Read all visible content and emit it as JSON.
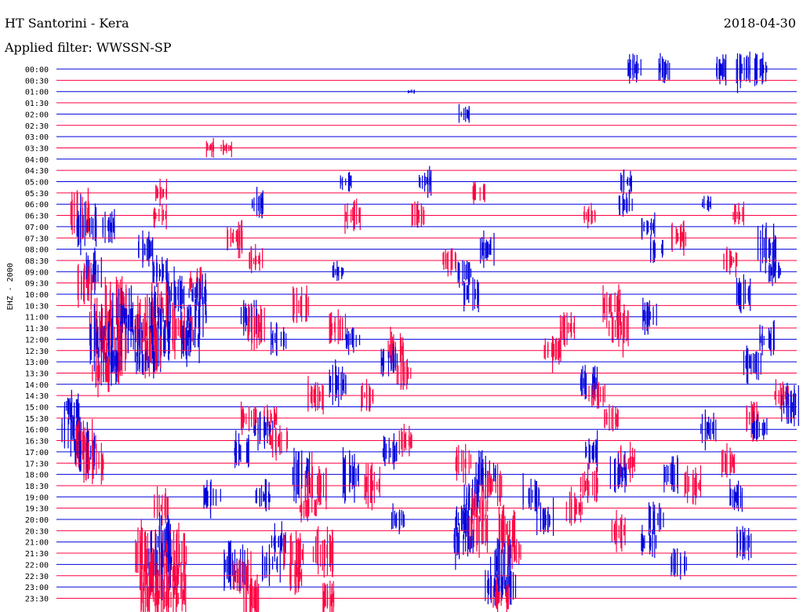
{
  "header": {
    "station": "HT Santorini - Kera",
    "date": "2018-04-30",
    "filter": "Applied filter: WWSSN-SP"
  },
  "chart_data": {
    "type": "helicorder",
    "channel_label": "EHZ - 2000",
    "row_labels": [
      "00:00",
      "00:30",
      "01:00",
      "01:30",
      "02:00",
      "02:30",
      "03:00",
      "03:30",
      "04:00",
      "04:30",
      "05:00",
      "05:30",
      "06:00",
      "06:30",
      "07:00",
      "07:30",
      "08:00",
      "08:30",
      "09:00",
      "09:30",
      "10:00",
      "10:30",
      "11:00",
      "11:30",
      "12:00",
      "12:30",
      "13:00",
      "13:30",
      "14:00",
      "14:30",
      "15:00",
      "15:30",
      "16:00",
      "16:30",
      "17:00",
      "17:30",
      "18:00",
      "18:30",
      "19:00",
      "19:30",
      "20:00",
      "20:30",
      "21:00",
      "21:30",
      "22:00",
      "22:30",
      "23:00",
      "23:30"
    ],
    "colors": {
      "even_row": "#0000dd",
      "odd_row": "#ff0040"
    },
    "rows": [
      {
        "time": "00:00",
        "bursts": [
          [
            0.78,
            0.5
          ],
          [
            0.82,
            0.5
          ],
          [
            0.9,
            0.5
          ],
          [
            0.93,
            0.7
          ],
          [
            0.95,
            0.5
          ]
        ]
      },
      {
        "time": "00:30",
        "bursts": []
      },
      {
        "time": "01:00",
        "bursts": [
          [
            0.48,
            0.1
          ]
        ]
      },
      {
        "time": "01:30",
        "bursts": []
      },
      {
        "time": "02:00",
        "bursts": [
          [
            0.55,
            0.3
          ]
        ]
      },
      {
        "time": "02:30",
        "bursts": []
      },
      {
        "time": "03:00",
        "bursts": []
      },
      {
        "time": "03:30",
        "bursts": [
          [
            0.21,
            0.3
          ],
          [
            0.23,
            0.3
          ]
        ]
      },
      {
        "time": "04:00",
        "bursts": []
      },
      {
        "time": "04:30",
        "bursts": []
      },
      {
        "time": "05:00",
        "bursts": [
          [
            0.39,
            0.4
          ],
          [
            0.5,
            0.5
          ],
          [
            0.77,
            0.4
          ]
        ]
      },
      {
        "time": "05:30",
        "bursts": [
          [
            0.14,
            0.4
          ],
          [
            0.57,
            0.4
          ]
        ]
      },
      {
        "time": "06:00",
        "bursts": [
          [
            0.27,
            0.5
          ],
          [
            0.77,
            0.5
          ],
          [
            0.88,
            0.3
          ]
        ]
      },
      {
        "time": "06:30",
        "bursts": [
          [
            0.03,
            0.9
          ],
          [
            0.14,
            0.4
          ],
          [
            0.4,
            0.6
          ],
          [
            0.49,
            0.5
          ],
          [
            0.72,
            0.4
          ],
          [
            0.92,
            0.4
          ]
        ]
      },
      {
        "time": "07:00",
        "bursts": [
          [
            0.04,
            0.9
          ],
          [
            0.07,
            0.6
          ],
          [
            0.8,
            0.5
          ]
        ]
      },
      {
        "time": "07:30",
        "bursts": [
          [
            0.24,
            0.6
          ],
          [
            0.84,
            0.6
          ]
        ]
      },
      {
        "time": "08:00",
        "bursts": [
          [
            0.12,
            0.6
          ],
          [
            0.58,
            0.6
          ],
          [
            0.81,
            0.5
          ],
          [
            0.96,
            0.8
          ]
        ]
      },
      {
        "time": "08:30",
        "bursts": [
          [
            0.27,
            0.5
          ],
          [
            0.53,
            0.5
          ],
          [
            0.91,
            0.5
          ]
        ]
      },
      {
        "time": "09:00",
        "bursts": [
          [
            0.05,
            0.7
          ],
          [
            0.14,
            0.5
          ],
          [
            0.38,
            0.3
          ],
          [
            0.55,
            0.5
          ],
          [
            0.97,
            0.5
          ]
        ]
      },
      {
        "time": "09:30",
        "bursts": [
          [
            0.04,
            0.8
          ],
          [
            0.19,
            0.5
          ]
        ]
      },
      {
        "time": "10:00",
        "bursts": [
          [
            0.16,
            0.8
          ],
          [
            0.19,
            0.7
          ],
          [
            0.56,
            0.6
          ],
          [
            0.93,
            0.6
          ]
        ]
      },
      {
        "time": "10:30",
        "bursts": [
          [
            0.08,
            0.9
          ],
          [
            0.14,
            0.8
          ],
          [
            0.33,
            0.6
          ],
          [
            0.75,
            0.7
          ]
        ]
      },
      {
        "time": "11:00",
        "bursts": [
          [
            0.09,
            0.9
          ],
          [
            0.14,
            0.9
          ],
          [
            0.19,
            0.8
          ],
          [
            0.26,
            0.6
          ],
          [
            0.8,
            0.6
          ]
        ]
      },
      {
        "time": "11:30",
        "bursts": [
          [
            0.06,
            1.0
          ],
          [
            0.12,
            1.0
          ],
          [
            0.17,
            0.9
          ],
          [
            0.27,
            0.7
          ],
          [
            0.38,
            0.6
          ],
          [
            0.69,
            0.6
          ],
          [
            0.76,
            0.8
          ]
        ]
      },
      {
        "time": "12:00",
        "bursts": [
          [
            0.06,
            1.0
          ],
          [
            0.1,
            1.0
          ],
          [
            0.14,
            0.9
          ],
          [
            0.18,
            0.8
          ],
          [
            0.3,
            0.6
          ],
          [
            0.4,
            0.5
          ],
          [
            0.96,
            0.6
          ]
        ]
      },
      {
        "time": "12:30",
        "bursts": [
          [
            0.08,
            1.0
          ],
          [
            0.13,
            0.9
          ],
          [
            0.46,
            0.7
          ],
          [
            0.67,
            0.6
          ]
        ]
      },
      {
        "time": "13:00",
        "bursts": [
          [
            0.07,
            0.8
          ],
          [
            0.12,
            0.7
          ],
          [
            0.45,
            0.6
          ],
          [
            0.94,
            0.7
          ]
        ]
      },
      {
        "time": "13:30",
        "bursts": [
          [
            0.06,
            0.7
          ],
          [
            0.47,
            0.6
          ]
        ]
      },
      {
        "time": "14:00",
        "bursts": [
          [
            0.38,
            0.7
          ],
          [
            0.72,
            0.7
          ]
        ]
      },
      {
        "time": "14:30",
        "bursts": [
          [
            0.35,
            0.6
          ],
          [
            0.42,
            0.5
          ],
          [
            0.73,
            0.6
          ],
          [
            0.98,
            0.5
          ]
        ]
      },
      {
        "time": "15:00",
        "bursts": [
          [
            0.02,
            0.5
          ],
          [
            0.99,
            0.8
          ]
        ]
      },
      {
        "time": "15:30",
        "bursts": [
          [
            0.26,
            0.6
          ],
          [
            0.29,
            0.5
          ],
          [
            0.75,
            0.5
          ],
          [
            0.94,
            0.7
          ]
        ]
      },
      {
        "time": "16:00",
        "bursts": [
          [
            0.02,
            0.8
          ],
          [
            0.28,
            0.7
          ],
          [
            0.88,
            0.6
          ],
          [
            0.95,
            0.5
          ]
        ]
      },
      {
        "time": "16:30",
        "bursts": [
          [
            0.04,
            0.8
          ],
          [
            0.3,
            0.7
          ],
          [
            0.47,
            0.5
          ]
        ]
      },
      {
        "time": "17:00",
        "bursts": [
          [
            0.04,
            0.9
          ],
          [
            0.25,
            0.6
          ],
          [
            0.45,
            0.6
          ],
          [
            0.72,
            0.6
          ]
        ]
      },
      {
        "time": "17:30",
        "bursts": [
          [
            0.05,
            0.8
          ],
          [
            0.55,
            0.6
          ],
          [
            0.77,
            0.6
          ],
          [
            0.91,
            0.6
          ]
        ]
      },
      {
        "time": "18:00",
        "bursts": [
          [
            0.33,
            0.8
          ],
          [
            0.4,
            0.8
          ],
          [
            0.58,
            0.8
          ],
          [
            0.76,
            0.7
          ],
          [
            0.83,
            0.6
          ]
        ]
      },
      {
        "time": "18:30",
        "bursts": [
          [
            0.35,
            0.9
          ],
          [
            0.43,
            0.8
          ],
          [
            0.59,
            0.8
          ],
          [
            0.72,
            0.7
          ],
          [
            0.86,
            0.6
          ]
        ]
      },
      {
        "time": "19:00",
        "bursts": [
          [
            0.21,
            0.7
          ],
          [
            0.28,
            0.6
          ],
          [
            0.56,
            0.7
          ],
          [
            0.64,
            0.7
          ],
          [
            0.92,
            0.6
          ]
        ]
      },
      {
        "time": "19:30",
        "bursts": [
          [
            0.14,
            0.6
          ],
          [
            0.34,
            0.6
          ],
          [
            0.57,
            0.7
          ],
          [
            0.7,
            0.6
          ]
        ]
      },
      {
        "time": "20:00",
        "bursts": [
          [
            0.46,
            0.5
          ],
          [
            0.55,
            0.7
          ],
          [
            0.66,
            0.6
          ],
          [
            0.81,
            0.5
          ]
        ]
      },
      {
        "time": "20:30",
        "bursts": [
          [
            0.57,
            0.8
          ],
          [
            0.61,
            0.8
          ],
          [
            0.76,
            0.6
          ]
        ]
      },
      {
        "time": "21:00",
        "bursts": [
          [
            0.14,
            0.9
          ],
          [
            0.3,
            0.6
          ],
          [
            0.55,
            0.8
          ],
          [
            0.8,
            0.5
          ],
          [
            0.93,
            0.6
          ]
        ]
      },
      {
        "time": "21:30",
        "bursts": [
          [
            0.12,
            1.0
          ],
          [
            0.16,
            1.0
          ],
          [
            0.32,
            0.8
          ],
          [
            0.36,
            0.8
          ],
          [
            0.62,
            0.6
          ]
        ]
      },
      {
        "time": "22:00",
        "bursts": [
          [
            0.14,
            1.0
          ],
          [
            0.24,
            0.9
          ],
          [
            0.29,
            0.7
          ],
          [
            0.6,
            0.8
          ],
          [
            0.84,
            0.6
          ]
        ]
      },
      {
        "time": "22:30",
        "bursts": [
          [
            0.13,
            1.0
          ],
          [
            0.16,
            0.9
          ],
          [
            0.25,
            0.8
          ],
          [
            0.32,
            0.6
          ]
        ]
      },
      {
        "time": "23:00",
        "bursts": [
          [
            0.59,
            0.7
          ],
          [
            0.61,
            0.7
          ]
        ]
      },
      {
        "time": "23:30",
        "bursts": [
          [
            0.13,
            1.0
          ],
          [
            0.16,
            0.9
          ],
          [
            0.26,
            0.8
          ],
          [
            0.37,
            0.6
          ],
          [
            0.6,
            0.6
          ]
        ]
      }
    ]
  }
}
